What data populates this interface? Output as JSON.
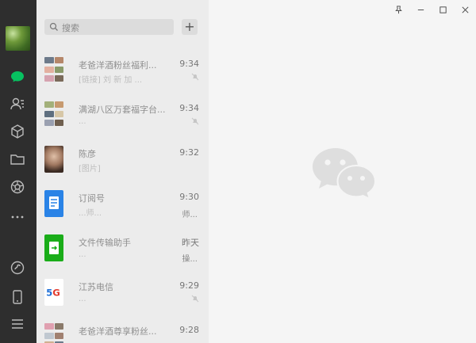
{
  "search": {
    "placeholder": "搜索"
  },
  "chats": [
    {
      "title": "老爸洋酒粉丝福利...",
      "subtitle": "[链接] 刘 新 加 ...",
      "time": "9:34"
    },
    {
      "title": "满湖八区万套福字台...",
      "subtitle": "...",
      "time": "9:34"
    },
    {
      "title": "陈彦",
      "subtitle": "[图片]",
      "time": "9:32"
    },
    {
      "title": "订阅号",
      "subtitle": "...师...",
      "time": "9:30",
      "right_text": "师..."
    },
    {
      "title": "文件传输助手",
      "subtitle": "...",
      "time": "昨天",
      "right_text": "操..."
    },
    {
      "title": "江苏电信",
      "subtitle": "...",
      "time": "9:29"
    },
    {
      "title": "老爸洋酒尊享粉丝...",
      "subtitle": "...",
      "time": "9:28"
    }
  ],
  "colors": {
    "accent": "#07c160",
    "sidebar": "#2e2e2e"
  }
}
